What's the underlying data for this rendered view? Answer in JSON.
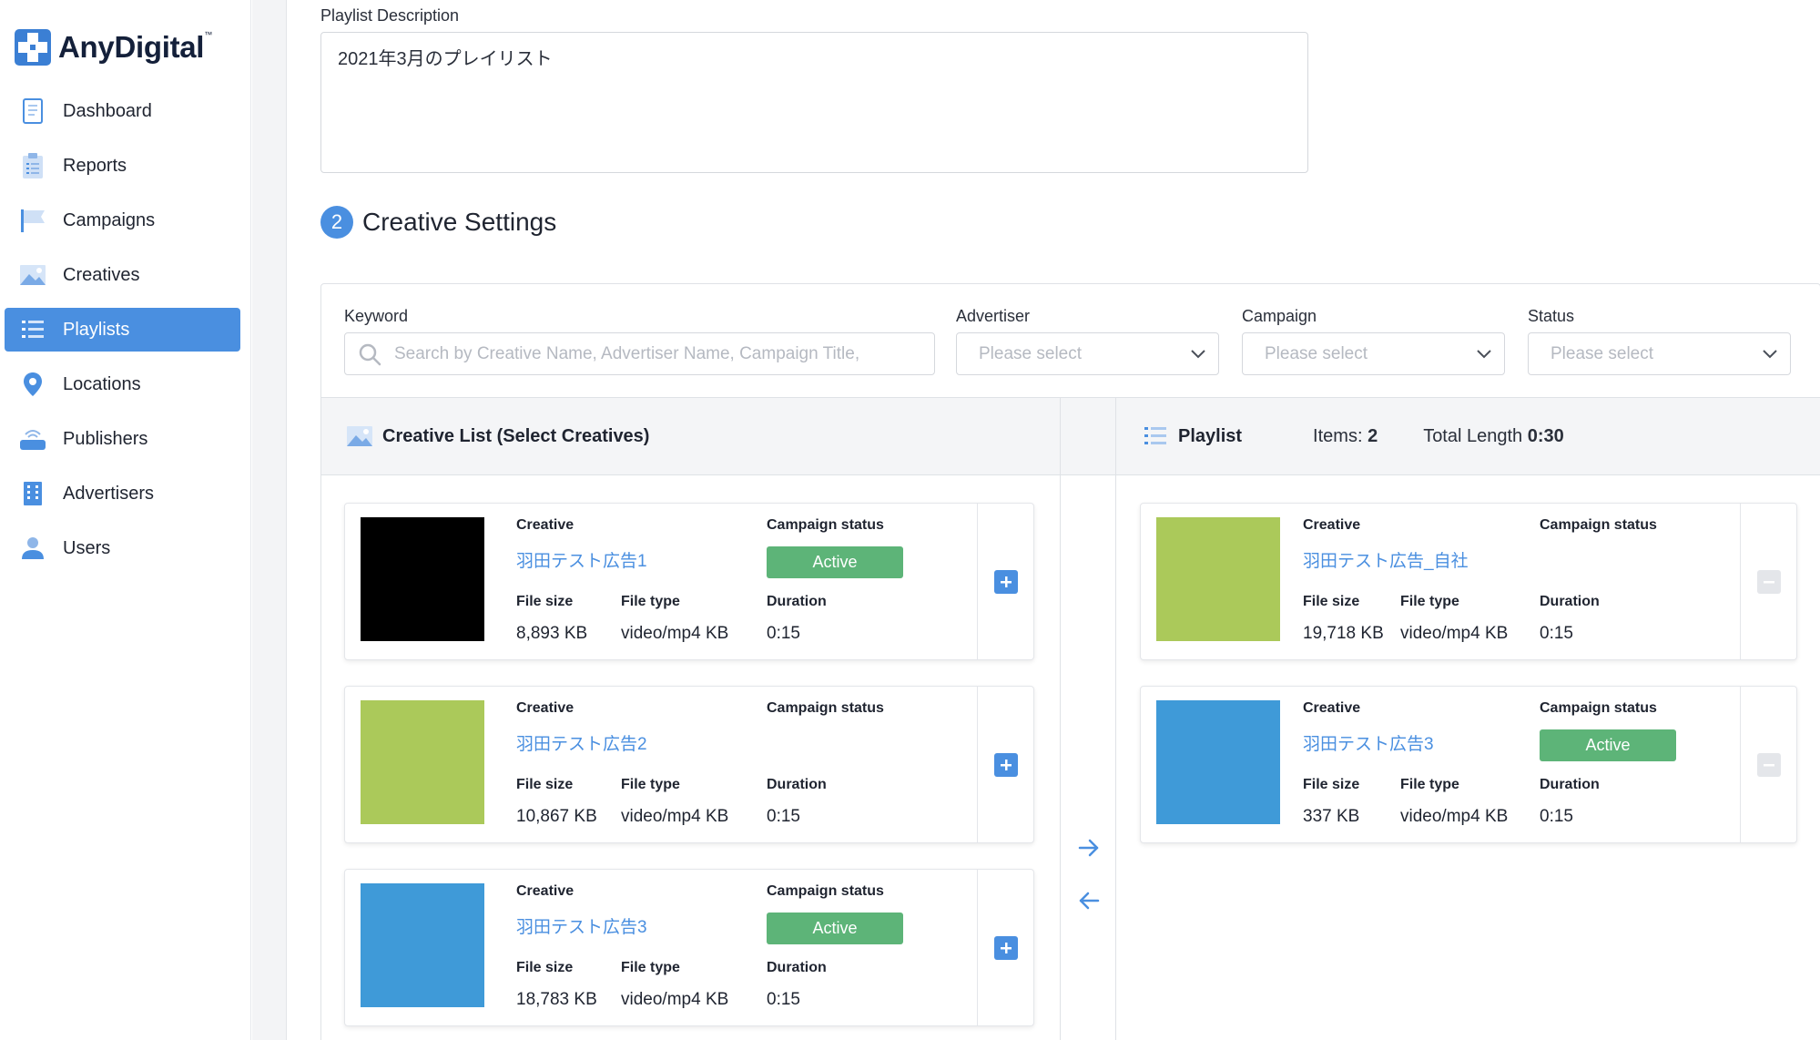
{
  "brand": {
    "name": "AnyDigital",
    "tm": "™"
  },
  "sidebar": {
    "items": [
      {
        "label": "Dashboard",
        "icon": "dashboard-icon"
      },
      {
        "label": "Reports",
        "icon": "reports-icon"
      },
      {
        "label": "Campaigns",
        "icon": "flag-icon"
      },
      {
        "label": "Creatives",
        "icon": "image-icon"
      },
      {
        "label": "Playlists",
        "icon": "list-icon",
        "active": true
      },
      {
        "label": "Locations",
        "icon": "pin-icon"
      },
      {
        "label": "Publishers",
        "icon": "router-icon"
      },
      {
        "label": "Advertisers",
        "icon": "building-icon"
      },
      {
        "label": "Users",
        "icon": "user-icon"
      }
    ]
  },
  "form": {
    "description_label": "Playlist Description",
    "description_value": "2021年3月のプレイリスト"
  },
  "section": {
    "number": "2",
    "title": "Creative Settings"
  },
  "filters": {
    "keyword_label": "Keyword",
    "keyword_placeholder": "Search by Creative Name, Advertiser Name, Campaign Title,",
    "advertiser_label": "Advertiser",
    "advertiser_placeholder": "Please select",
    "campaign_label": "Campaign",
    "campaign_placeholder": "Please select",
    "status_label": "Status",
    "status_placeholder": "Please select"
  },
  "labels": {
    "creative": "Creative",
    "campaign_status": "Campaign status",
    "file_size": "File size",
    "file_type": "File type",
    "duration": "Duration"
  },
  "creative_list": {
    "title": "Creative List (Select Creatives)",
    "items": [
      {
        "name": "羽田テスト広告1",
        "status": "Active",
        "file_size": "8,893 KB",
        "file_type": "video/mp4 KB",
        "duration": "0:15",
        "color": "#000000"
      },
      {
        "name": "羽田テスト広告2",
        "status": "",
        "file_size": "10,867 KB",
        "file_type": "video/mp4 KB",
        "duration": "0:15",
        "color": "#abc95a"
      },
      {
        "name": "羽田テスト広告3",
        "status": "Active",
        "file_size": "18,783 KB",
        "file_type": "video/mp4 KB",
        "duration": "0:15",
        "color": "#3f9ad8"
      }
    ]
  },
  "playlist": {
    "title": "Playlist",
    "items_label": "Items:",
    "items_count": "2",
    "length_label": "Total Length",
    "length_value": "0:30",
    "items": [
      {
        "name": "羽田テスト広告_自社",
        "status": "",
        "file_size": "19,718 KB",
        "file_type": "video/mp4 KB",
        "duration": "0:15",
        "color": "#abc95a"
      },
      {
        "name": "羽田テスト広告3",
        "status": "Active",
        "file_size": "337 KB",
        "file_type": "video/mp4 KB",
        "duration": "0:15",
        "color": "#3f9ad8"
      }
    ]
  },
  "colors": {
    "accent": "#4a8fe0",
    "active_badge": "#5db478"
  }
}
